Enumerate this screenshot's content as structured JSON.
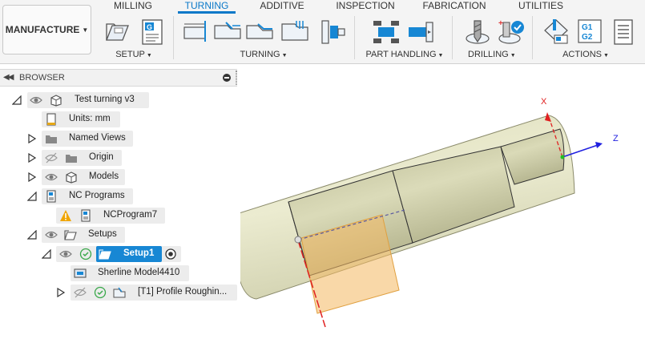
{
  "toolbar": {
    "workspace": "MANUFACTURE",
    "tabs": [
      "MILLING",
      "TURNING",
      "ADDITIVE",
      "INSPECTION",
      "FABRICATION",
      "UTILITIES"
    ],
    "active_tab": "TURNING",
    "groups": {
      "setup": "SETUP",
      "turning": "TURNING",
      "part_handling": "PART HANDLING",
      "drilling": "DRILLING",
      "actions": "ACTIONS"
    },
    "icons": {
      "setup": [
        "new-setup-icon",
        "nc-program-icon"
      ],
      "turning": [
        "face-icon",
        "profile-roughing-icon",
        "profile-finishing-icon",
        "groove-icon",
        "chamfer-icon"
      ],
      "part_handling": [
        "part-transfer-icon",
        "bar-pull-icon"
      ],
      "drilling": [
        "drill-icon",
        "drill-hole-recognition-icon"
      ],
      "actions": [
        "simulate-icon",
        "post-process-icon",
        "setup-sheet-icon"
      ]
    },
    "accent_color": "#0a78c8"
  },
  "browser": {
    "title": "BROWSER",
    "tree": {
      "root": "Test turning v3",
      "units": "Units: mm",
      "named_views": "Named Views",
      "origin": "Origin",
      "models": "Models",
      "nc_programs": "NC Programs",
      "nc_program_7": "NCProgram7",
      "setups": "Setups",
      "setup1": "Setup1",
      "machine": "Sherline Model4410",
      "operation": "[T1] Profile Roughin..."
    },
    "selection_color": "#1787d4"
  },
  "viewport": {
    "axis_x": "X",
    "axis_z": "Z"
  }
}
